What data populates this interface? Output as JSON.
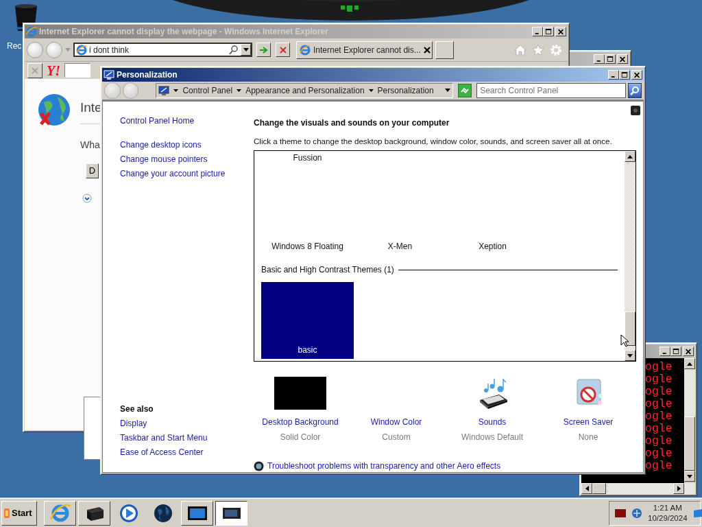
{
  "desktop": {
    "icons": [
      {
        "label": "Rec"
      }
    ]
  },
  "ie_window": {
    "title": "Internet Explorer cannot display the webpage - Windows Internet Explorer",
    "active": false,
    "address": "i dont think",
    "tab": "Internet Explorer cannot dis...",
    "logo": "Y!",
    "page_heading": "Inte",
    "page_text": "Wha",
    "page_button": "D"
  },
  "back_window": {
    "active": false
  },
  "personalization": {
    "title": "Personalization",
    "active": true,
    "breadcrumbs": [
      "Control Panel",
      "Appearance and Personalization",
      "Personalization"
    ],
    "search": {
      "placeholder": "Search Control Panel"
    },
    "sidebar": {
      "links": [
        "Control Panel Home",
        "Change desktop icons",
        "Change mouse pointers",
        "Change your account picture"
      ],
      "see_also_title": "See also",
      "see_also": [
        "Display",
        "Taskbar and Start Menu",
        "Ease of Access Center"
      ]
    },
    "heading": "Change the visuals and sounds on your computer",
    "description": "Click a theme to change the desktop background, window color, sounds, and screen saver all at once.",
    "themes_top": [
      {
        "name": "Fussion"
      }
    ],
    "themes": [
      {
        "name": "Windows 8 Floating"
      },
      {
        "name": "X-Men"
      },
      {
        "name": "Xeption"
      }
    ],
    "group": "Basic and High Contrast Themes (1)",
    "basic_themes": [
      {
        "name": "basic"
      }
    ],
    "settings": [
      {
        "kind": "background",
        "label": "Desktop Background",
        "value": "Solid Color"
      },
      {
        "kind": "color",
        "label": "Window Color",
        "value": "Custom"
      },
      {
        "kind": "sounds",
        "label": "Sounds",
        "value": "Windows Default"
      },
      {
        "kind": "saver",
        "label": "Screen Saver",
        "value": "None"
      }
    ],
    "troubleshoot": "Troubleshoot problems with transparency and other Aero effects"
  },
  "console_window": {
    "active": false,
    "lines": [
      "ogle",
      "ogle",
      "ogle",
      "ogle",
      "ogle",
      "ogle",
      "ogle",
      "ogle",
      "ogle"
    ]
  },
  "taskbar": {
    "start": "Start",
    "buttons": [
      {
        "kind": "ie",
        "selected": false
      },
      {
        "kind": "printer",
        "selected": false
      },
      {
        "kind": "media",
        "selected": false
      },
      {
        "kind": "globe",
        "selected": false
      },
      {
        "kind": "monitor",
        "selected": false
      },
      {
        "kind": "display",
        "selected": true
      }
    ],
    "clock": {
      "time": "1:21 AM",
      "date": "10/29/2024"
    }
  }
}
